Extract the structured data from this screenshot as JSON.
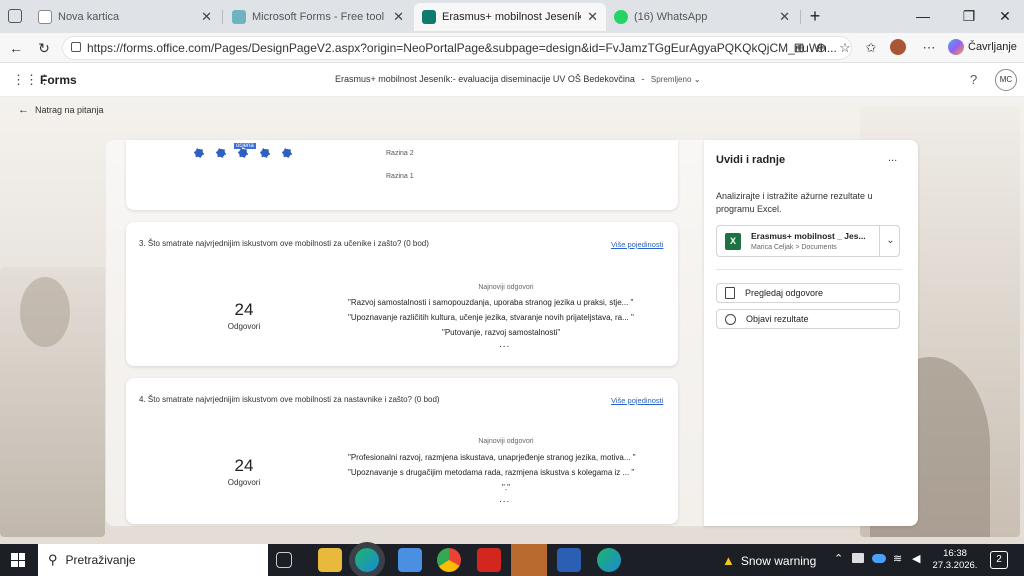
{
  "browser": {
    "tabs": [
      {
        "label": "Nova kartica",
        "active": false
      },
      {
        "label": "Microsoft Forms - Free tool to cre...",
        "active": false
      },
      {
        "label": "Erasmus+ mobilnost  Jeseník:- eva...",
        "active": true
      },
      {
        "label": "(16) WhatsApp",
        "active": false
      }
    ],
    "new_tab": "+",
    "url": "https://forms.office.com/Pages/DesignPageV2.aspx?origin=NeoPortalPage&subpage=design&id=FvJamzTGgEurAgyaPQKQkQjCM_rtuWh...",
    "profile_label": "Čavrljanje"
  },
  "forms_header": {
    "app_name": "Forms",
    "form_title": "Erasmus+ mobilnost  Jeseník:- evaluacija diseminacije  UV OŠ Bedekovčina",
    "sep": "-",
    "status": "Spremljeno",
    "help": "?",
    "avatar": "MC"
  },
  "back_label": "Natrag na pitanja",
  "top_card": {
    "selected_label": "ocjena",
    "levels": [
      "Razina 2",
      "Razina 1"
    ]
  },
  "questions": [
    {
      "title": "3. Što smatrate najvrjednijim iskustvom ove mobilnosti za učenike i zašto? (0 bod)",
      "more": "Više pojedinosti",
      "count": "24",
      "count_label": "Odgovori",
      "latest_label": "Najnoviji odgovori",
      "responses": [
        "\"Razvoj samostalnosti i samopouzdanja, uporaba stranog jezika u praksi, stje... \"",
        "\"Upoznavanje različitih kultura, učenje jezika, stvaranje novih prijateljstava, ra... \"",
        "\"Putovanje, razvoj samostalnosti\""
      ],
      "ellipsis": "..."
    },
    {
      "title": "4. Što smatrate najvrjednijim iskustvom ove mobilnosti za nastavnike i zašto? (0 bod)",
      "more": "Više pojedinosti",
      "count": "24",
      "count_label": "Odgovori",
      "latest_label": "Najnoviji odgovori",
      "responses": [
        "\"Profesionalni razvoj, razmjena iskustava, unaprjeđenje stranog jezika, motiva... \"",
        "\"Upoznavanje s drugačijim metodama rada, razmjena iskustva s kolegama iz ... \"",
        "\".\""
      ],
      "ellipsis": "..."
    }
  ],
  "panel": {
    "title": "Uvidi i radnje",
    "menu": "...",
    "desc": "Analizirajte i istražite ažurne rezultate u programu Excel.",
    "file_name": "Erasmus+ mobilnost _ Jes...",
    "file_path": "Marica Celjak > Documents",
    "btn_view": "Pregledaj odgovore",
    "btn_publish": "Objavi rezultate"
  },
  "taskbar": {
    "search": "Pretraživanje",
    "weather": "Snow warning",
    "time": "16:38",
    "date": "27.3.2026.",
    "notif": "2"
  },
  "colors": {
    "accent": "#2a62c9",
    "excel": "#1e7145",
    "forms": "#0f7b6c",
    "taskbar": "#1c1f26"
  }
}
